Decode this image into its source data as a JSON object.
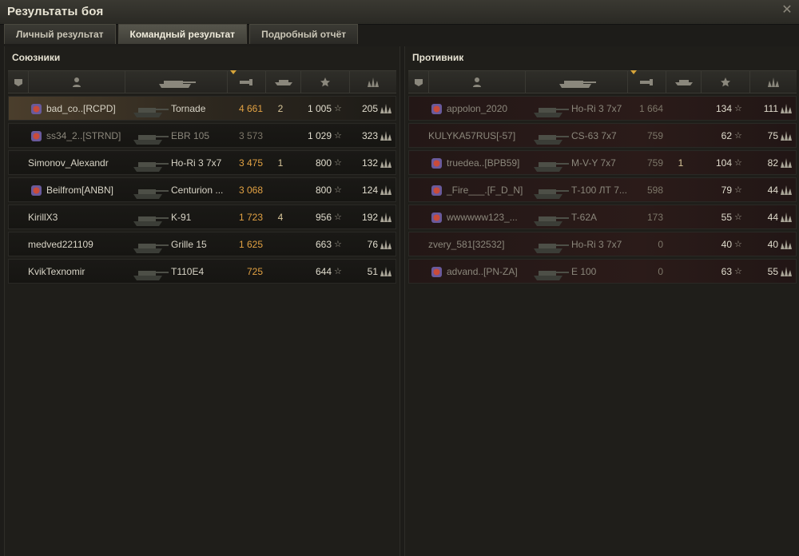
{
  "window": {
    "title": "Результаты боя"
  },
  "tabs": [
    {
      "label": "Личный результат",
      "active": false
    },
    {
      "label": "Командный результат",
      "active": true
    },
    {
      "label": "Подробный отчёт",
      "active": false
    }
  ],
  "allies": {
    "title": "Союзники",
    "rows": [
      {
        "player": "bad_co..[RCPD]",
        "vehicle": "Tornade",
        "damage": "4 661",
        "kills": "2",
        "xp": "1 005",
        "free_xp": "205",
        "highlight": true,
        "badge": "clan-emblem-icon"
      },
      {
        "player": "ss34_2..[STRND]",
        "vehicle": "EBR 105",
        "damage": "3 573",
        "kills": "",
        "xp": "1 029",
        "free_xp": "323",
        "dead": true,
        "badge": "clan-emblem-icon"
      },
      {
        "player": "Simonov_Alexandr",
        "vehicle": "Ho-Ri 3 7x7",
        "damage": "3 475",
        "kills": "1",
        "xp": "800",
        "free_xp": "132"
      },
      {
        "player": "Beilfrom[ANBN]",
        "vehicle": "Centurion ...",
        "damage": "3 068",
        "kills": "",
        "xp": "800",
        "free_xp": "124",
        "badge": "clan-emblem-icon"
      },
      {
        "player": "KirillX3",
        "vehicle": "K-91",
        "damage": "1 723",
        "kills": "4",
        "xp": "956",
        "free_xp": "192"
      },
      {
        "player": "medved221109",
        "vehicle": "Grille 15",
        "damage": "1 625",
        "kills": "",
        "xp": "663",
        "free_xp": "76"
      },
      {
        "player": "KvikTexnomir",
        "vehicle": "T110E4",
        "damage": "725",
        "kills": "",
        "xp": "644",
        "free_xp": "51"
      }
    ]
  },
  "enemies": {
    "title": "Противник",
    "rows": [
      {
        "player": "appolon_2020",
        "vehicle": "Ho-Ri 3 7x7",
        "damage": "1 664",
        "kills": "",
        "xp": "134",
        "free_xp": "111",
        "badge": "clan-emblem-icon",
        "dim": true
      },
      {
        "player": "KULYKA57RUS[-57]",
        "vehicle": "CS-63 7x7",
        "damage": "759",
        "kills": "",
        "xp": "62",
        "free_xp": "75",
        "dim": true
      },
      {
        "player": "truedea..[BPB59]",
        "vehicle": "M-V-Y 7x7",
        "damage": "759",
        "kills": "1",
        "xp": "104",
        "free_xp": "82",
        "badge": "clan-emblem-icon",
        "dim": true
      },
      {
        "player": "_Fire___.[F_D_N]",
        "vehicle": "Т-100 ЛТ 7...",
        "damage": "598",
        "kills": "",
        "xp": "79",
        "free_xp": "44",
        "badge": "clan-emblem-icon",
        "dim": true
      },
      {
        "player": "wwwwww123_...",
        "vehicle": "T-62A",
        "damage": "173",
        "kills": "",
        "xp": "55",
        "free_xp": "44",
        "badge": "clan-emblem-icon",
        "dim": true
      },
      {
        "player": "zvery_581[32532]",
        "vehicle": "Ho-Ri 3 7x7",
        "damage": "0",
        "kills": "",
        "xp": "40",
        "free_xp": "40",
        "dim": true
      },
      {
        "player": "advand..[PN-ZA]",
        "vehicle": "E 100",
        "damage": "0",
        "kills": "",
        "xp": "63",
        "free_xp": "55",
        "badge": "clan-emblem-icon",
        "dim": true
      }
    ]
  },
  "icons": {
    "columns": [
      "squad-icon",
      "player-icon",
      "vehicle-icon",
      "damage-icon",
      "kills-icon",
      "xp-star-icon",
      "free-xp-icon"
    ],
    "row_xp": "star-icon",
    "row_free_xp": "wings-icon",
    "close": "close-icon"
  },
  "colors": {
    "damage_highlight": "#e2a243",
    "accent": "#d6a43a"
  }
}
